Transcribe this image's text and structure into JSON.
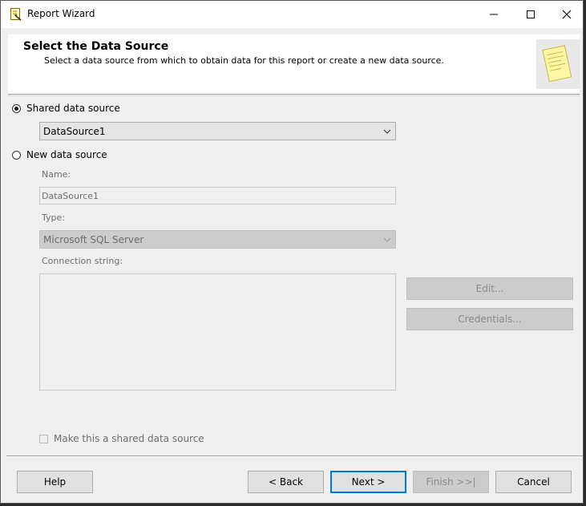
{
  "window": {
    "title": "Report Wizard"
  },
  "header": {
    "title": "Select the Data Source",
    "subtitle": "Select a data source from which to obtain data for this report or create a new data source."
  },
  "shared": {
    "radio_label": "Shared data source",
    "selected": true,
    "dropdown_value": "DataSource1"
  },
  "new_source": {
    "radio_label": "New data source",
    "selected": false,
    "name_label": "Name:",
    "name_value": "DataSource1",
    "type_label": "Type:",
    "type_value": "Microsoft SQL Server",
    "conn_label": "Connection string:",
    "conn_value": "",
    "edit_label": "Edit...",
    "credentials_label": "Credentials...",
    "make_shared_label": "Make this a shared data source",
    "make_shared_checked": false
  },
  "footer": {
    "help": "Help",
    "back": "< Back",
    "next": "Next >",
    "finish": "Finish >>|",
    "cancel": "Cancel"
  }
}
